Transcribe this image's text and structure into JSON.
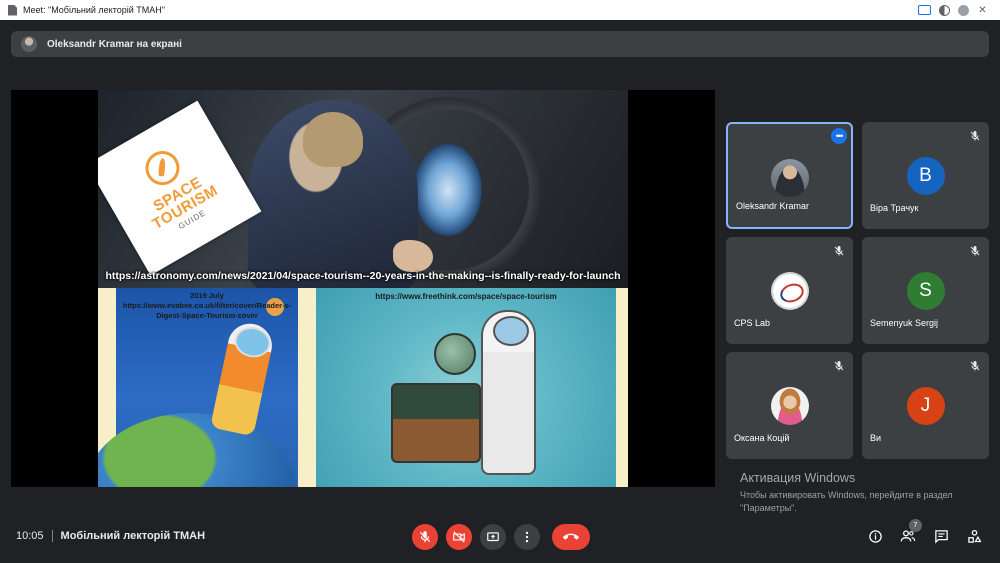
{
  "window": {
    "title": "Meet: \"Мобільний лекторій ТМАН\""
  },
  "presenter_bar": {
    "text": "Oleksandr Kramar на екрані"
  },
  "shared_screen": {
    "logo_title": "SPACE TOURISM",
    "logo_sub": "GUIDE",
    "url_top": "https://astronomy.com/news/2021/04/space-tourism--20-years-in-the-making--is-finally-ready-for-launch",
    "left_caption_date": "2019 July",
    "left_caption_url1": "https://www.evabee.co.uk/filter/cover/Reader-s-",
    "left_caption_url2": "Digest-Space-Tourism-cover",
    "right_caption": "https://www.freethink.com/space/space-tourism"
  },
  "participants": [
    {
      "name": "Oleksandr Kramar",
      "initial": "",
      "color": "",
      "active": true
    },
    {
      "name": "Віра Трачук",
      "initial": "В",
      "color": "#1565c0",
      "active": false
    },
    {
      "name": "CPS Lab",
      "initial": "",
      "color": "",
      "active": false
    },
    {
      "name": "Semenyuk Sergij",
      "initial": "S",
      "color": "#2e7d32",
      "active": false
    },
    {
      "name": "Оксана Коцій",
      "initial": "",
      "color": "",
      "active": false
    },
    {
      "name": "Ви",
      "initial": "J",
      "color": "#d84315",
      "active": false
    }
  ],
  "watermark": {
    "line1": "Активация Windows",
    "line2": "Чтобы активировать Windows, перейдите в раздел \"Параметры\"."
  },
  "bottom_bar": {
    "time": "10:05",
    "meeting_title": "Мобільний лекторій ТМАН",
    "participant_count": "7"
  },
  "colors": {
    "background": "#202124",
    "tile": "#3c4043",
    "accent": "#8ab4f8",
    "danger": "#ea4335"
  }
}
